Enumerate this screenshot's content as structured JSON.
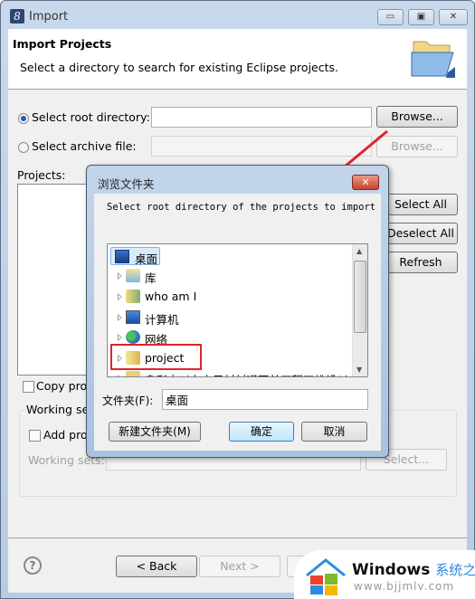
{
  "window": {
    "title": "Import",
    "app_icon": "eclipse-icon",
    "controls": {
      "minimize": "minimize-icon",
      "maximize": "maximize-icon",
      "close": "close-icon"
    }
  },
  "header": {
    "title": "Import Projects",
    "description": "Select a directory to search for existing Eclipse projects.",
    "icon": "open-folder-icon"
  },
  "source": {
    "root_directory_label": "Select root directory:",
    "root_directory_selected": true,
    "root_directory_value": "",
    "archive_label": "Select archive file:",
    "archive_selected": false,
    "archive_value": "",
    "browse_label": "Browse...",
    "browse_archive_label": "Browse..."
  },
  "projects": {
    "label": "Projects:",
    "items": [],
    "select_all": "Select All",
    "deselect_all": "Deselect All",
    "refresh": "Refresh"
  },
  "options": {
    "copy_projects_label": "Copy projects into workspace",
    "copy_projects_checked": false,
    "working_sets_group": "Working sets",
    "add_project_label": "Add project to working sets",
    "add_project_checked": false,
    "working_sets_label": "Working sets:",
    "working_sets_value": "",
    "select_label": "Select..."
  },
  "footer": {
    "help_icon": "help-icon",
    "back": "< Back",
    "next": "Next >"
  },
  "browse_dialog": {
    "title": "浏览文件夹",
    "description": "Select root directory of the projects to import",
    "tree": [
      {
        "label": "桌面",
        "icon": "desktop-icon",
        "selected": true,
        "expandable": false
      },
      {
        "label": "库",
        "icon": "library-icon",
        "selected": false,
        "expandable": true
      },
      {
        "label": "who am I",
        "icon": "user-folder-icon",
        "selected": false,
        "expandable": true
      },
      {
        "label": "计算机",
        "icon": "computer-icon",
        "selected": false,
        "expandable": true
      },
      {
        "label": "网络",
        "icon": "network-icon",
        "selected": false,
        "expandable": true
      },
      {
        "label": "project",
        "icon": "folder-icon",
        "selected": false,
        "expandable": true,
        "highlighted": true
      },
      {
        "label": "身彩忠以办电示材材通要并工程工维设以",
        "icon": "folder-icon",
        "selected": false,
        "expandable": true
      }
    ],
    "folder_label": "文件夹(F):",
    "folder_value": "桌面",
    "new_folder": "新建文件夹(M)",
    "ok": "确定",
    "cancel": "取消"
  },
  "watermark": {
    "brand": "Windows",
    "brand_cn": "系统之家",
    "url": "www.bjjmlv.com"
  },
  "colors": {
    "annotation_red": "#e0232a",
    "selection_blue": "#cce8ff",
    "watermark_blue": "#2a8ce0"
  }
}
